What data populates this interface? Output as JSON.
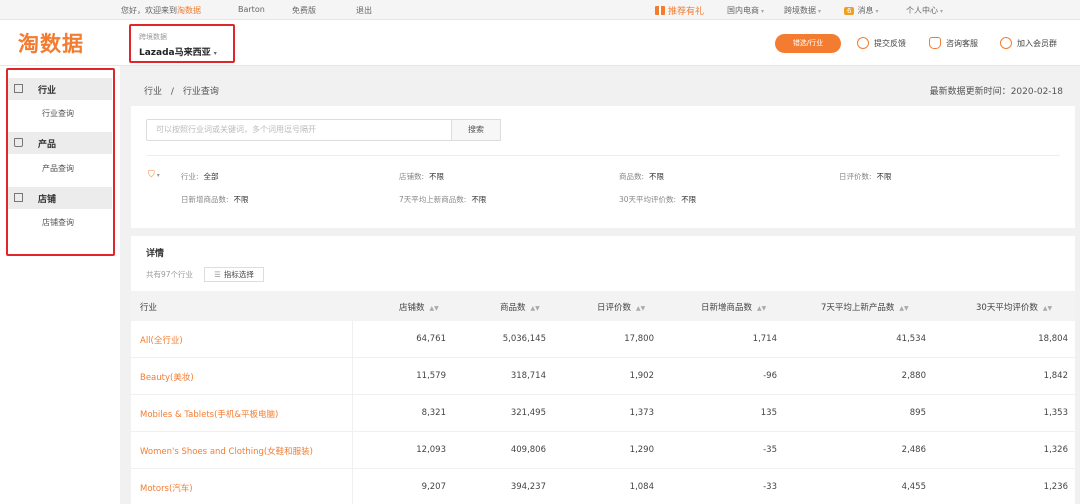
{
  "topbar": {
    "greeting": "您好，欢迎来到",
    "brand_link": "淘数据",
    "user": "Barton",
    "plan": "免费版",
    "logout": "退出",
    "promo": "推荐有礼",
    "nav": [
      "国内电商",
      "跨境数据"
    ],
    "msg_badge": "6",
    "msg": "消息",
    "account": "个人中心"
  },
  "header": {
    "logo": "淘数据",
    "market_label": "跨境数据",
    "market_value": "Lazada马来西亚",
    "orange_btn": "错选/行业",
    "feedback": "提交反馈",
    "support": "咨询客服",
    "join": "加入会员群"
  },
  "sidebar": {
    "groups": [
      {
        "label": "行业",
        "sub": "行业查询"
      },
      {
        "label": "产品",
        "sub": "产品查询"
      },
      {
        "label": "店铺",
        "sub": "店铺查询"
      }
    ]
  },
  "breadcrumb": {
    "root": "行业",
    "sep": "/",
    "current": "行业查询"
  },
  "update": {
    "label": "最新数据更新时间：",
    "date": "2020-02-18"
  },
  "search": {
    "placeholder": "可以按照行业词或关键词，多个词用逗号隔开",
    "button": "搜索"
  },
  "filters": [
    {
      "label": "行业:",
      "value": "全部"
    },
    {
      "label": "店铺数:",
      "value": "不限"
    },
    {
      "label": "商品数:",
      "value": "不限"
    },
    {
      "label": "日评价数:",
      "value": "不限"
    },
    {
      "label": "日新增商品数:",
      "value": "不限"
    },
    {
      "label": "7天平均上新商品数:",
      "value": "不限"
    },
    {
      "label": "30天平均评价数:",
      "value": "不限"
    }
  ],
  "detail": {
    "title": "详情",
    "count": "共有97个行业",
    "metric_btn": "指标选择",
    "columns": [
      "行业",
      "店铺数",
      "商品数",
      "日评价数",
      "日新增商品数",
      "7天平均上新产品数",
      "30天平均评价数"
    ],
    "rows": [
      [
        "All(全行业)",
        "64,761",
        "5,036,145",
        "17,800",
        "1,714",
        "41,534",
        "18,804"
      ],
      [
        "Beauty(美妆)",
        "11,579",
        "318,714",
        "1,902",
        "-96",
        "2,880",
        "1,842"
      ],
      [
        "Mobiles & Tablets(手机&平板电脑)",
        "8,321",
        "321,495",
        "1,373",
        "135",
        "895",
        "1,353"
      ],
      [
        "Women's Shoes and Clothing(女鞋和服装)",
        "12,093",
        "409,806",
        "1,290",
        "-35",
        "2,486",
        "1,326"
      ],
      [
        "Motors(汽车)",
        "9,207",
        "394,237",
        "1,084",
        "-33",
        "4,455",
        "1,236"
      ]
    ]
  },
  "colors": {
    "accent": "#f47c30",
    "highlight": "#e0262b"
  },
  "icons": [
    "gift-icon",
    "chat-icon",
    "headset-icon",
    "user-group-icon",
    "grid-icon",
    "bag-icon",
    "store-icon",
    "filter-icon"
  ]
}
